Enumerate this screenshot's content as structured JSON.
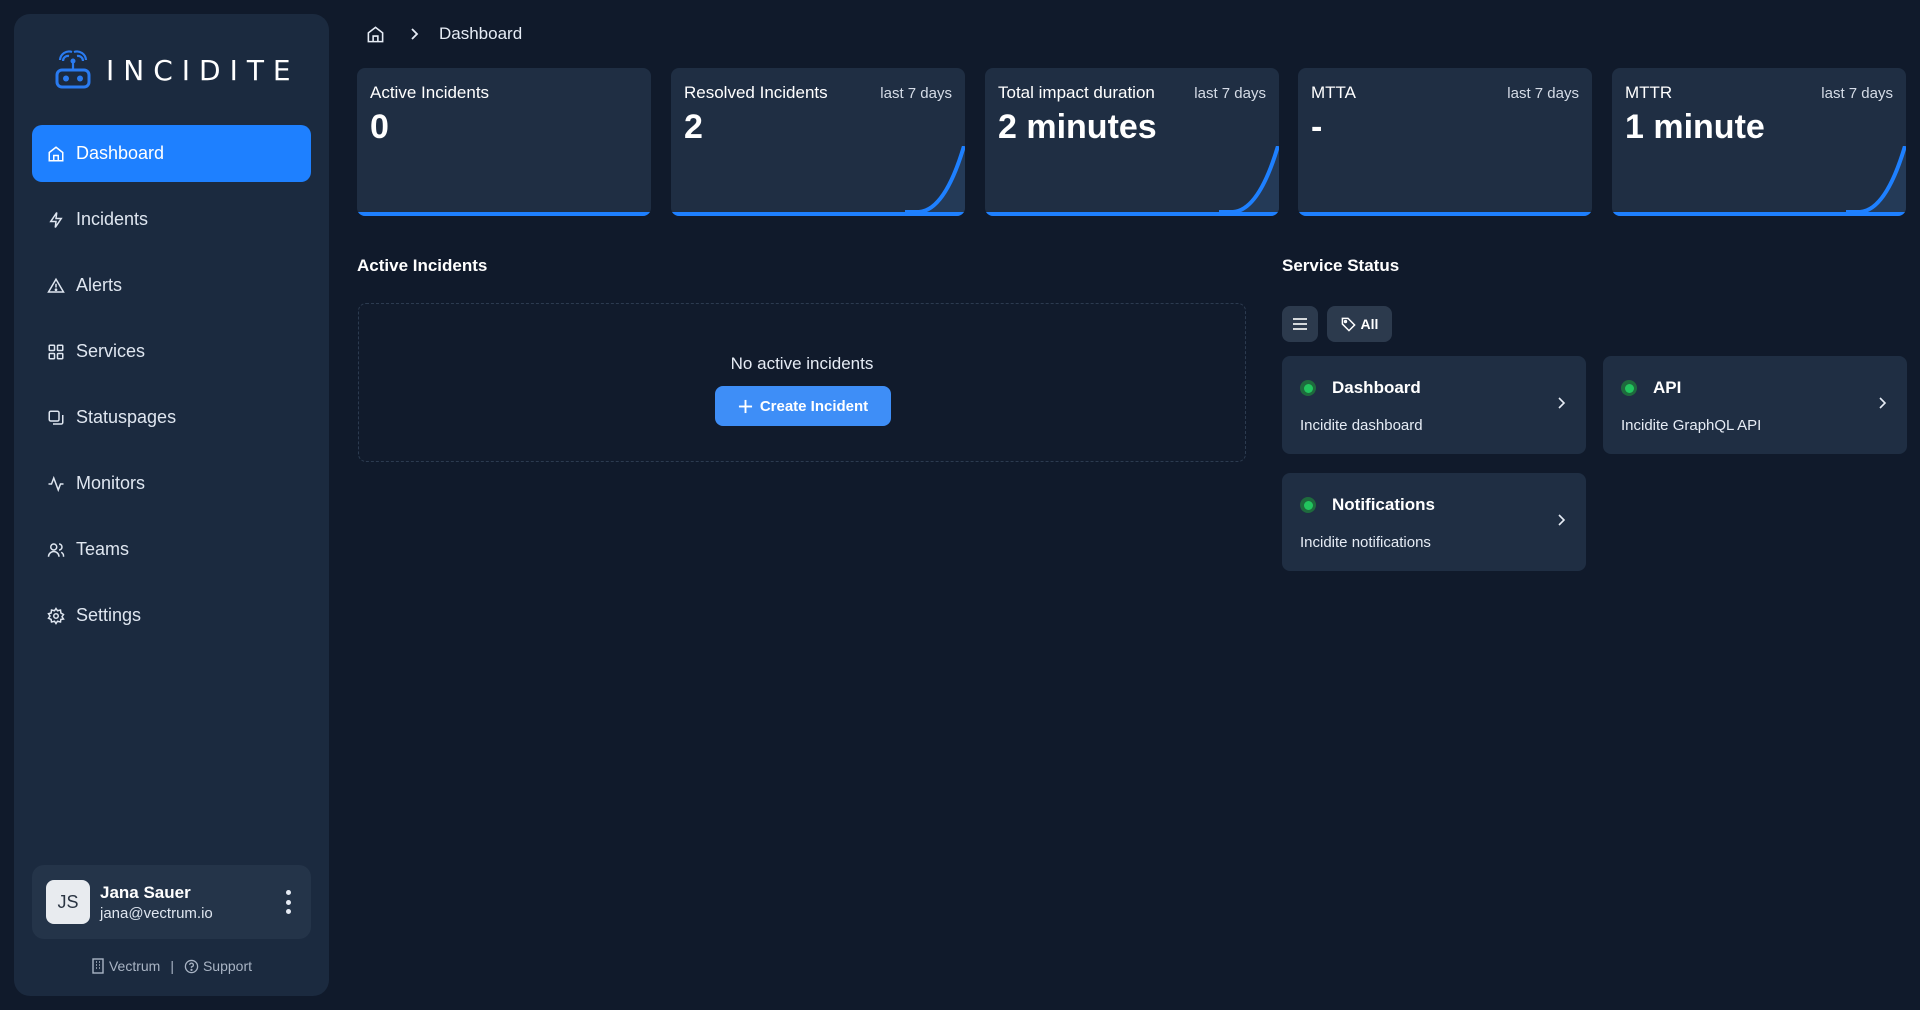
{
  "app": {
    "brand": "INCIDITE",
    "accent": "#1e80ff"
  },
  "sidebar": {
    "items": [
      {
        "label": "Dashboard",
        "icon": "home-icon",
        "active": true
      },
      {
        "label": "Incidents",
        "icon": "bolt-icon"
      },
      {
        "label": "Alerts",
        "icon": "warning-icon"
      },
      {
        "label": "Services",
        "icon": "grid-icon"
      },
      {
        "label": "Statuspages",
        "icon": "pages-icon"
      },
      {
        "label": "Monitors",
        "icon": "activity-icon"
      },
      {
        "label": "Teams",
        "icon": "users-icon"
      },
      {
        "label": "Settings",
        "icon": "gear-icon"
      }
    ],
    "user": {
      "initials": "JS",
      "name": "Jana Sauer",
      "email": "jana@vectrum.io"
    },
    "footer": {
      "org": "Vectrum",
      "separator": "|",
      "support": "Support"
    }
  },
  "breadcrumb": {
    "current": "Dashboard"
  },
  "stats": [
    {
      "title": "Active Incidents",
      "period": "",
      "value": "0",
      "trend": false
    },
    {
      "title": "Resolved Incidents",
      "period": "last 7 days",
      "value": "2",
      "trend": true
    },
    {
      "title": "Total impact duration",
      "period": "last 7 days",
      "value": "2 minutes",
      "trend": true
    },
    {
      "title": "MTTA",
      "period": "last 7 days",
      "value": "-",
      "trend": false
    },
    {
      "title": "MTTR",
      "period": "last 7 days",
      "value": "1 minute",
      "trend": true
    }
  ],
  "active_incidents": {
    "title": "Active Incidents",
    "empty_text": "No active incidents",
    "create_label": "Create Incident"
  },
  "service_status": {
    "title": "Service Status",
    "filter_all": "All",
    "services": [
      {
        "name": "Dashboard",
        "description": "Incidite dashboard",
        "status": "operational",
        "status_color": "#22c55e"
      },
      {
        "name": "API",
        "description": "Incidite GraphQL API",
        "status": "operational",
        "status_color": "#22c55e"
      },
      {
        "name": "Notifications",
        "description": "Incidite notifications",
        "status": "operational",
        "status_color": "#22c55e"
      }
    ]
  }
}
